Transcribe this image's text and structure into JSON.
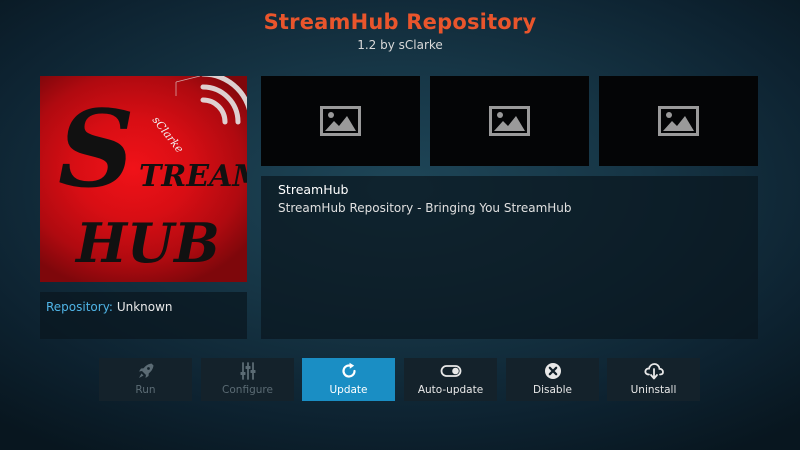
{
  "header": {
    "title": "StreamHub Repository",
    "subtitle": "1.2 by sClarke"
  },
  "fanart": {
    "letter_s": "S",
    "word_tream": "TREAM",
    "word_hub": "HUB",
    "signature": "sClarke",
    "colors": {
      "background": "#d80e14",
      "text": "#111111"
    }
  },
  "repository": {
    "label": "Repository:",
    "value": "Unknown"
  },
  "screenshots": {
    "icon": "image-placeholder-icon"
  },
  "description": {
    "name": "StreamHub",
    "text": "StreamHub Repository - Bringing You StreamHub"
  },
  "actions": [
    {
      "label": "Run",
      "icon": "rocket-icon",
      "enabled": false
    },
    {
      "label": "Configure",
      "icon": "sliders-icon",
      "enabled": false
    },
    {
      "label": "Update",
      "icon": "refresh-icon",
      "enabled": true,
      "focused": true
    },
    {
      "label": "Auto-update",
      "icon": "toggle-icon",
      "enabled": true
    },
    {
      "label": "Disable",
      "icon": "close-circle-icon",
      "enabled": true
    },
    {
      "label": "Uninstall",
      "icon": "cloud-download-icon",
      "enabled": true
    }
  ],
  "colors": {
    "title": "#e9552c",
    "accent": "#1a8ec4",
    "repo_label": "#4fb4e6",
    "disabled_text": "#5b6b74"
  }
}
